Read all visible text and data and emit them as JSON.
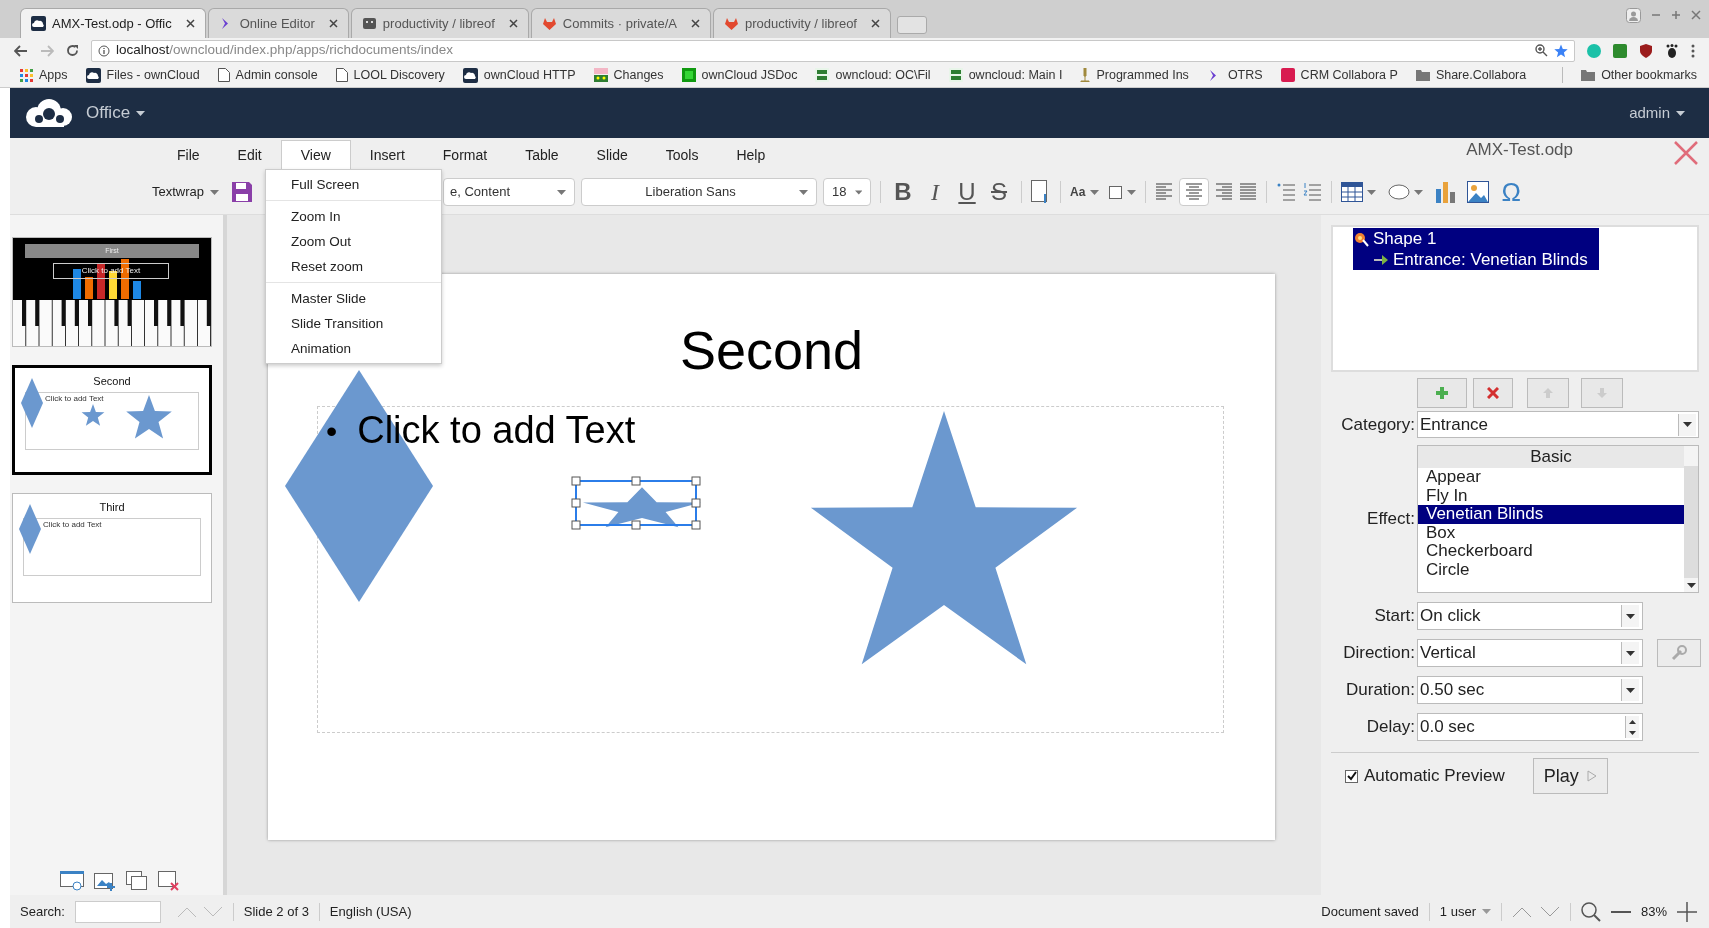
{
  "browser": {
    "tabs": [
      {
        "title": "AMX-Test.odp - Offic",
        "selected": true
      },
      {
        "title": "Online Editor",
        "selected": false
      },
      {
        "title": "productivity / libreof",
        "selected": false
      },
      {
        "title": "Commits · private/A",
        "selected": false
      },
      {
        "title": "productivity / libreof",
        "selected": false
      }
    ],
    "address": {
      "host": "localhost",
      "path": "/owncloud/index.php/apps/richdocuments/index"
    },
    "bookmarks": [
      "Apps",
      "Files - ownCloud",
      "Admin console",
      "LOOL Discovery",
      "ownCloud HTTP",
      "Changes",
      "ownCloud JSDoc",
      "owncloud: OC\\Fil",
      "owncloud: Main I",
      "Programmed Ins",
      "OTRS",
      "CRM Collabora P",
      "Share.Collabora"
    ],
    "other_bookmarks": "Other bookmarks"
  },
  "app": {
    "name": "Office",
    "user": "admin"
  },
  "menu": [
    {
      "label": "File",
      "selected": false
    },
    {
      "label": "Edit",
      "selected": false
    },
    {
      "label": "View",
      "selected": true
    },
    {
      "label": "Insert",
      "selected": false
    },
    {
      "label": "Format",
      "selected": false
    },
    {
      "label": "Table",
      "selected": false
    },
    {
      "label": "Slide",
      "selected": false
    },
    {
      "label": "Tools",
      "selected": false
    },
    {
      "label": "Help",
      "selected": false
    }
  ],
  "view_menu": [
    [
      "Full Screen"
    ],
    [
      "Zoom In",
      "Zoom Out",
      "Reset zoom"
    ],
    [
      "Master Slide",
      "Slide Transition",
      "Animation"
    ]
  ],
  "document_title": "AMX-Test.odp",
  "toolbar": {
    "textwrap": "Textwrap",
    "style": "e, Content",
    "font": "Liberation Sans",
    "size": "18",
    "format": [
      "B",
      "I",
      "U",
      "S"
    ],
    "case": "Aa",
    "special": "Ω"
  },
  "slides": [
    {
      "kind": "piano_chart",
      "title": "First",
      "body": "Click to add Text",
      "selected": false
    },
    {
      "kind": "diamond_stars",
      "title": "Second",
      "body": "Click to add Text",
      "selected": true
    },
    {
      "kind": "diamond",
      "title": "Third",
      "body": "Click to add Text",
      "selected": false
    }
  ],
  "slide": {
    "title": "Second",
    "bullet": "•",
    "text": "Click to add Text"
  },
  "sidebar": {
    "tree": [
      {
        "label": "Shape 1",
        "selected": true,
        "children": [
          {
            "label": "Entrance: Venetian Blinds",
            "selected": true
          }
        ]
      }
    ],
    "category_label": "Category:",
    "category": "Entrance",
    "effect_label": "Effect:",
    "effect_group": "Basic",
    "effects": [
      {
        "label": "Appear",
        "selected": false
      },
      {
        "label": "Fly In",
        "selected": false
      },
      {
        "label": "Venetian Blinds",
        "selected": true
      },
      {
        "label": "Box",
        "selected": false
      },
      {
        "label": "Checkerboard",
        "selected": false
      },
      {
        "label": "Circle",
        "selected": false
      }
    ],
    "fields": [
      {
        "label": "Start:",
        "value": "On click",
        "kind": "dropdown"
      },
      {
        "label": "Direction:",
        "value": "Vertical",
        "kind": "dropdown_options"
      },
      {
        "label": "Duration:",
        "value": "0.50 sec",
        "kind": "dropdown"
      },
      {
        "label": "Delay:",
        "value": "0.0 sec",
        "kind": "spinner"
      }
    ],
    "automatic_preview": {
      "label": "Automatic Preview",
      "checked": true
    },
    "play": "Play"
  },
  "status_bar": {
    "search_label": "Search:",
    "slide": "Slide 2 of 3",
    "language": "English (USA)",
    "save_state": "Document saved",
    "users": "1 user",
    "zoom": "83%"
  }
}
